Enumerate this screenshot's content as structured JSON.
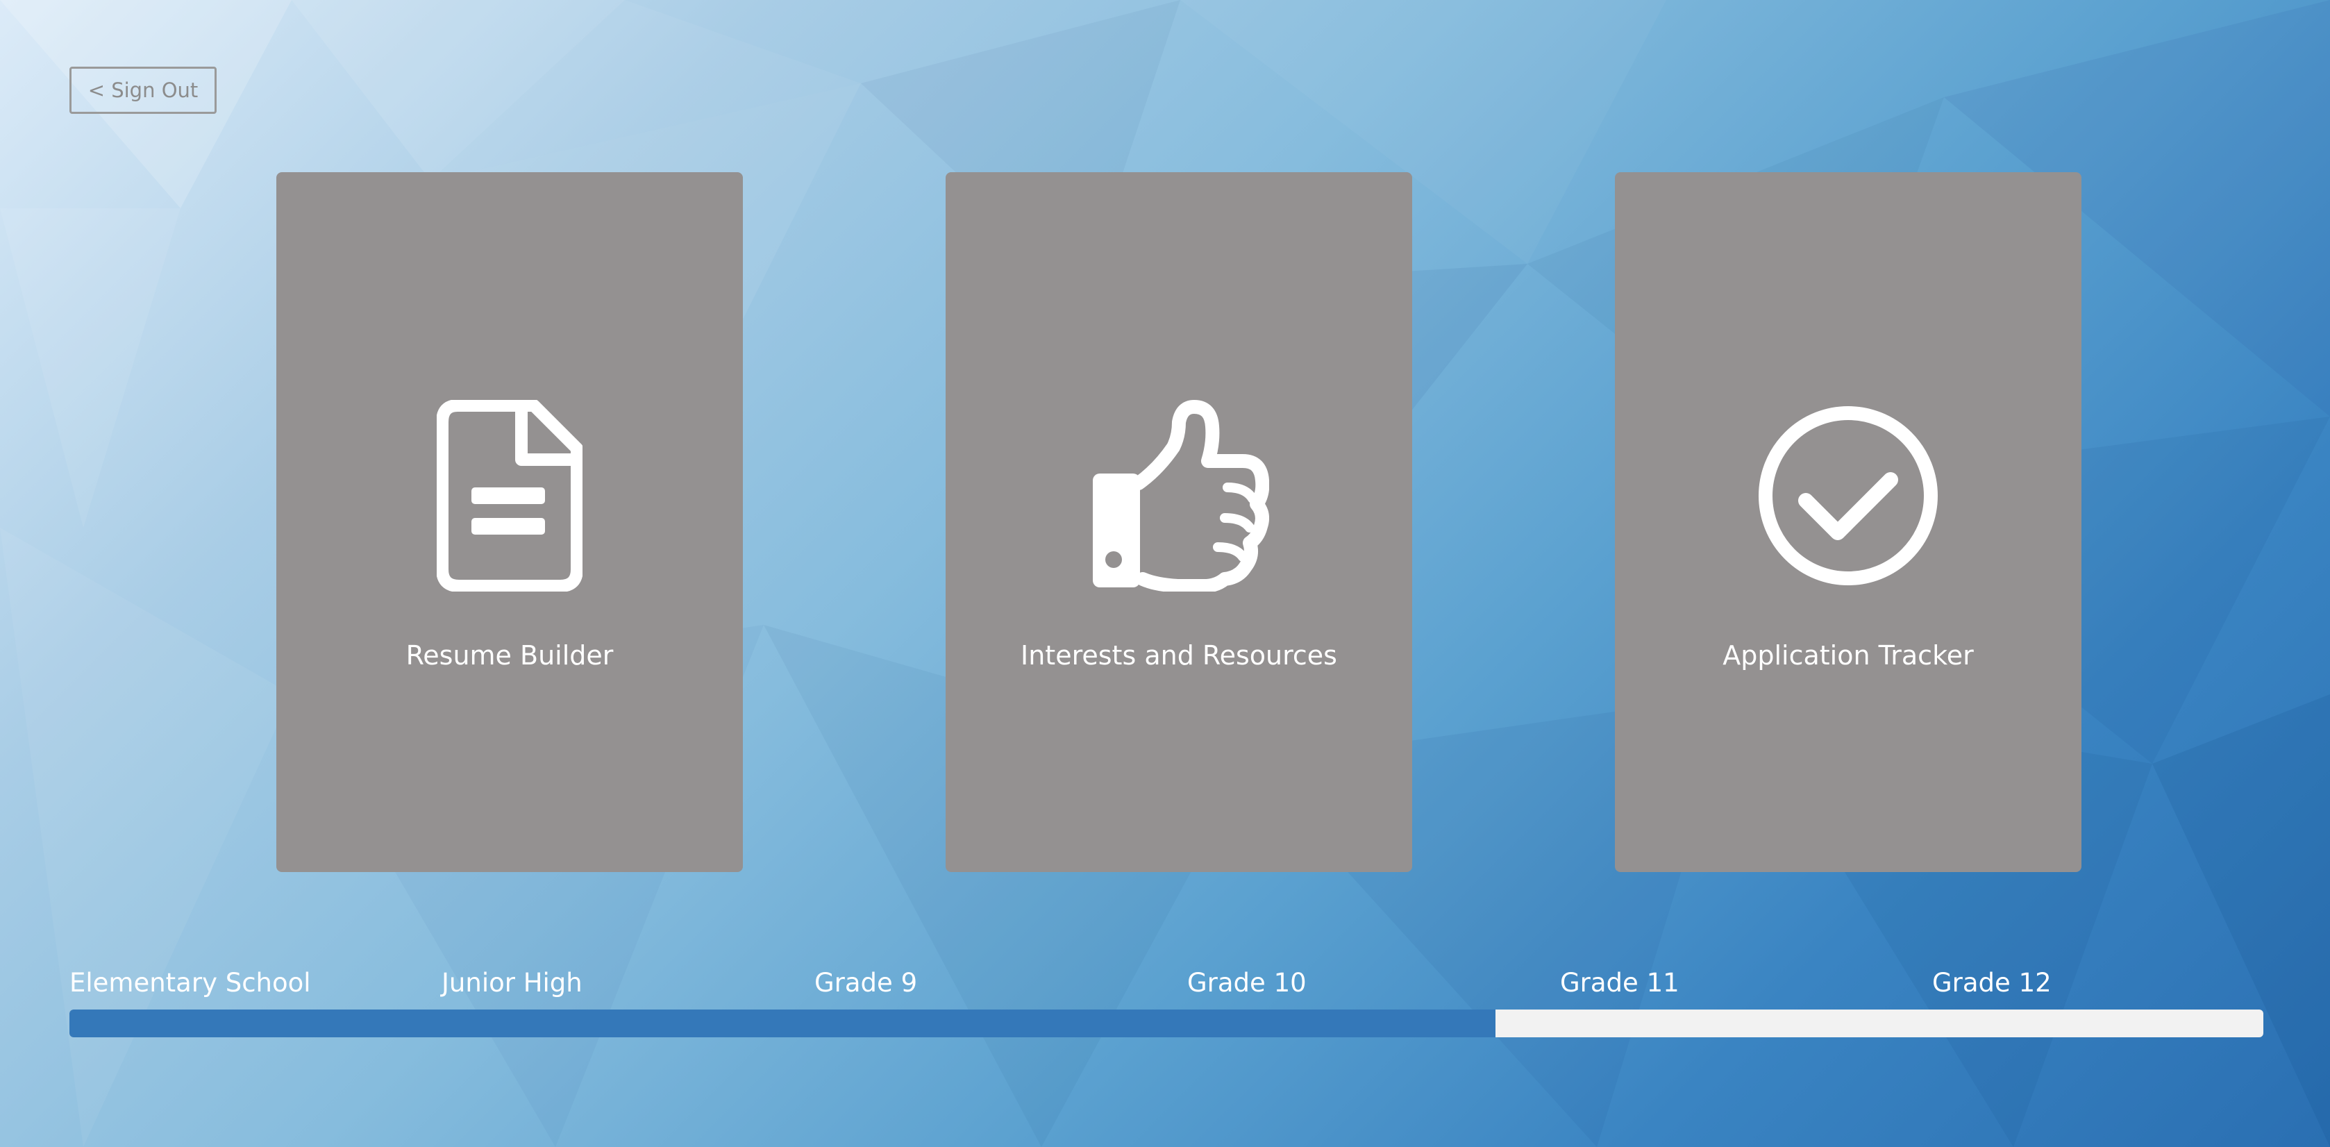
{
  "header": {
    "signout_label": "< Sign Out"
  },
  "cards": [
    {
      "label": "Resume Builder",
      "icon": "document-icon"
    },
    {
      "label": "Interests and Resources",
      "icon": "thumbs-up-icon"
    },
    {
      "label": "Application Tracker",
      "icon": "check-circle-icon"
    }
  ],
  "timeline": {
    "stages": [
      "Elementary School",
      "Junior High",
      "Grade 9",
      "Grade 10",
      "Grade 11",
      "Grade 12"
    ],
    "progress_fraction": 0.65
  },
  "colors": {
    "card_background": "#949191",
    "progress_fill": "#3478b9",
    "progress_track": "#f2f2f2"
  }
}
